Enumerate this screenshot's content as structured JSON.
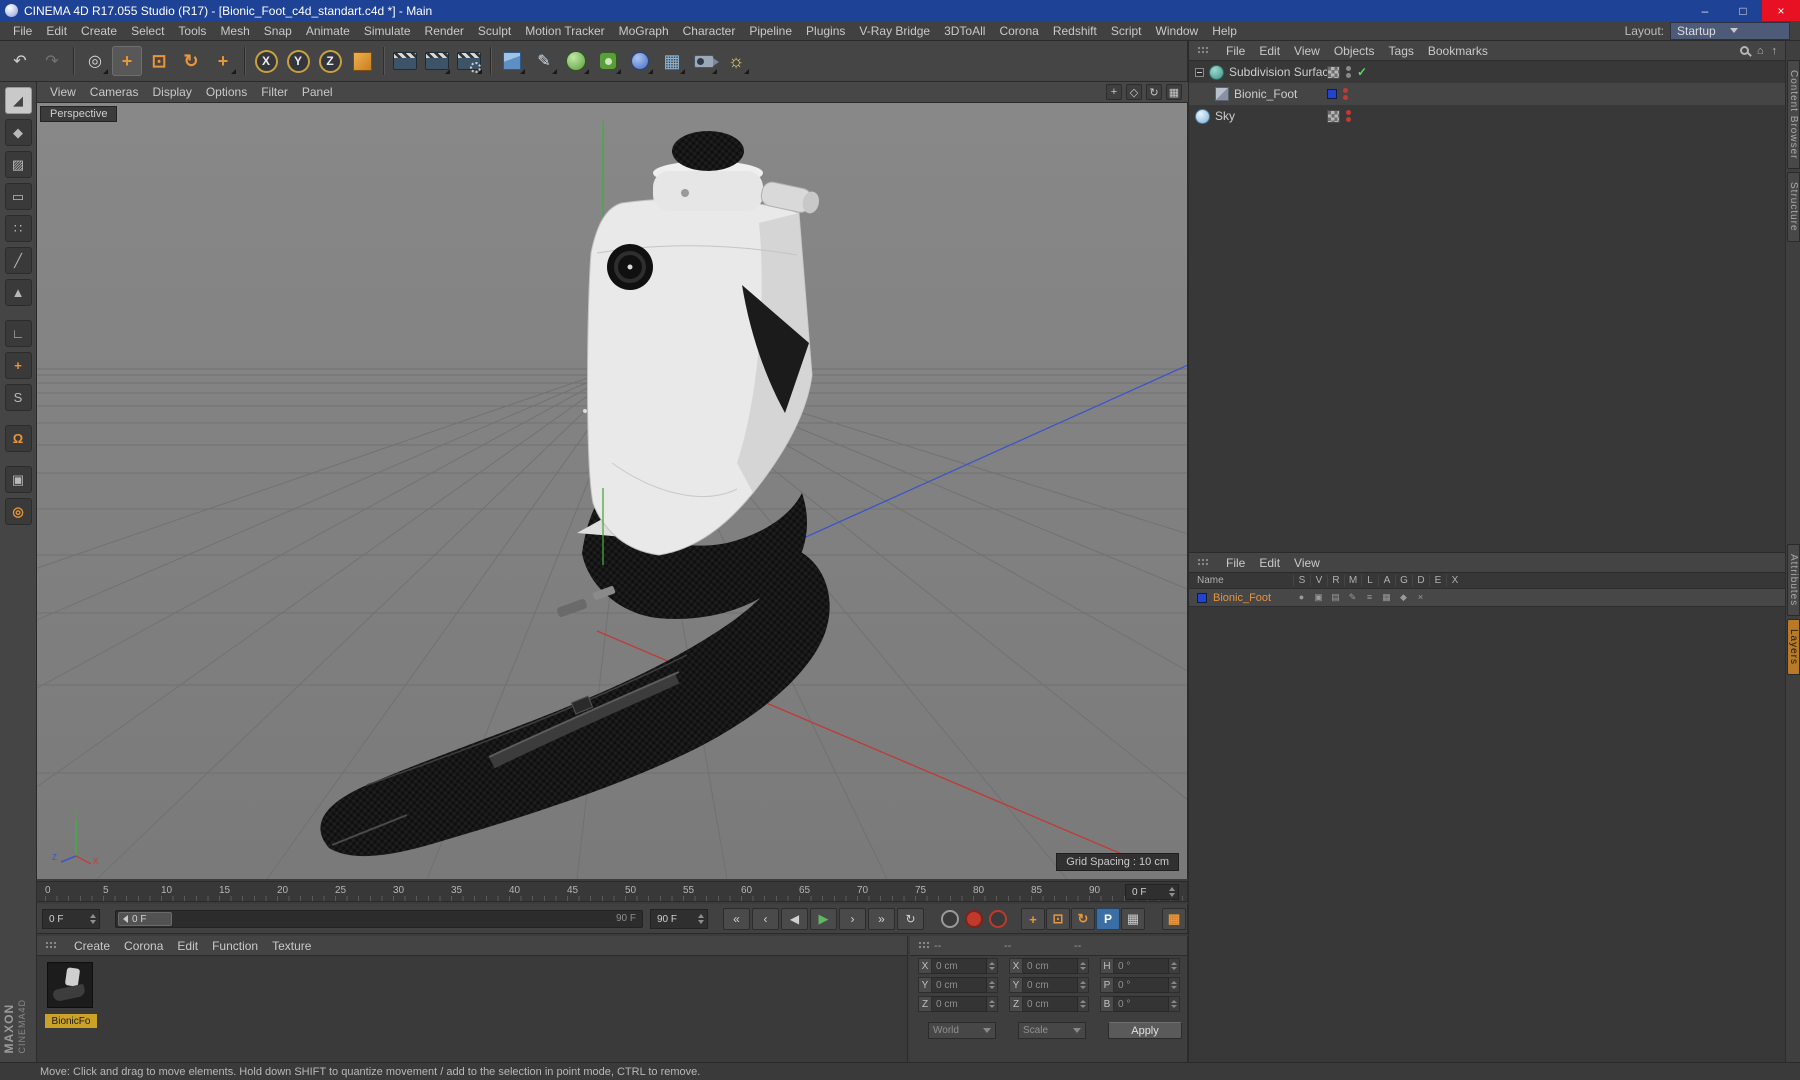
{
  "colors": {
    "title_blue": "#1e4296",
    "close_red": "#e81123",
    "accent_orange": "#e8953c",
    "play_green": "#5fb75f",
    "label_yellow": "#c9a227",
    "sel_orange": "#e39440"
  },
  "window": {
    "title": "CINEMA 4D R17.055 Studio (R17) - [Bionic_Foot_c4d_standart.c4d *] - Main",
    "minimize_glyph": "–",
    "maximize_glyph": "□",
    "close_glyph": "×"
  },
  "menubar": {
    "items": [
      "File",
      "Edit",
      "Create",
      "Select",
      "Tools",
      "Mesh",
      "Snap",
      "Animate",
      "Simulate",
      "Render",
      "Sculpt",
      "Motion Tracker",
      "MoGraph",
      "Character",
      "Pipeline",
      "Plugins",
      "V-Ray Bridge",
      "3DToAll",
      "Corona",
      "Redshift",
      "Script",
      "Window",
      "Help"
    ],
    "layout_label": "Layout:",
    "layout_value": "Startup"
  },
  "icons": {
    "undo": "↶",
    "redo": "↷",
    "selection": "◎",
    "move": "+",
    "scale": "⊡",
    "rotate": "↻",
    "last_tool": "+",
    "axis_x": "X",
    "axis_y": "Y",
    "axis_z": "Z",
    "pen": "✎",
    "floor": "▦",
    "light": "☼",
    "home": "⌂",
    "up_arrow": "↑",
    "p_key": "P",
    "grid": "▦",
    "transport": [
      "«",
      "‹",
      "◀",
      "▶",
      "›",
      "»",
      "↻"
    ],
    "record": [
      "●",
      "●",
      "◎"
    ],
    "viewport_nav": [
      "+",
      "◇",
      "↻",
      "▦"
    ]
  },
  "palette": [
    {
      "name": "make-editable",
      "glyph": "◢"
    },
    {
      "name": "model-mode",
      "glyph": "◆"
    },
    {
      "name": "texture-mode",
      "glyph": "▨"
    },
    {
      "name": "workplane-mode",
      "glyph": "▭"
    },
    {
      "name": "points-mode",
      "glyph": "∷"
    },
    {
      "name": "edges-mode",
      "glyph": "╱"
    },
    {
      "name": "polygons-mode",
      "glyph": "▲"
    },
    {
      "name": "axis-mode",
      "glyph": "∟"
    },
    {
      "name": "enable-axis",
      "glyph": "+"
    },
    {
      "name": "snap-settings",
      "glyph": "S"
    },
    {
      "name": "magnet-snap",
      "glyph": "Ω"
    },
    {
      "name": "lock-workplane",
      "glyph": "▣"
    },
    {
      "name": "quantize",
      "glyph": "◎"
    }
  ],
  "viewport": {
    "menus": [
      "View",
      "Cameras",
      "Display",
      "Options",
      "Filter",
      "Panel"
    ],
    "label": "Perspective",
    "grid_spacing": "Grid Spacing : 10 cm",
    "axis_x": "X",
    "axis_y": "Y",
    "axis_z": "Z"
  },
  "timeline": {
    "ticks": [
      "0",
      "5",
      "10",
      "15",
      "20",
      "25",
      "30",
      "35",
      "40",
      "45",
      "50",
      "55",
      "60",
      "65",
      "70",
      "75",
      "80",
      "85",
      "90"
    ],
    "current": "0 F",
    "range_start": "0 F",
    "range_end_label": "90 F",
    "range_end": "90 F"
  },
  "materials": {
    "menus": [
      "Create",
      "Corona",
      "Edit",
      "Function",
      "Texture"
    ],
    "material_name": "BionicFo"
  },
  "coordinates": {
    "dashes": [
      "--",
      "--",
      "--"
    ],
    "rows": [
      {
        "pos_label": "X",
        "pos": "0 cm",
        "size_label": "X",
        "size": "0 cm",
        "rot_label": "H",
        "rot": "0 °"
      },
      {
        "pos_label": "Y",
        "pos": "0 cm",
        "size_label": "Y",
        "size": "0 cm",
        "rot_label": "P",
        "rot": "0 °"
      },
      {
        "pos_label": "Z",
        "pos": "0 cm",
        "size_label": "Z",
        "size": "0 cm",
        "rot_label": "B",
        "rot": "0 °"
      }
    ],
    "world": "World",
    "scale": "Scale",
    "apply": "Apply"
  },
  "object_manager": {
    "menus": [
      "File",
      "Edit",
      "View",
      "Objects",
      "Tags",
      "Bookmarks"
    ],
    "items": [
      {
        "name": "Subdivision Surface"
      },
      {
        "name": "Bionic_Foot"
      },
      {
        "name": "Sky"
      }
    ]
  },
  "layer_manager": {
    "menus": [
      "File",
      "Edit",
      "View"
    ],
    "name_header": "Name",
    "columns": [
      "S",
      "V",
      "R",
      "M",
      "L",
      "A",
      "G",
      "D",
      "E",
      "X"
    ],
    "row_name": "Bionic_Foot",
    "row_icons": [
      "●",
      "▣",
      "▤",
      "✎",
      "≡",
      "▦",
      "◆",
      "×"
    ]
  },
  "side_tabs": {
    "tab1": "Content Browser",
    "tab2": "Structure",
    "tab3": "Attributes",
    "tab4": "Layers"
  },
  "branding": {
    "line1": "MAXON",
    "line2": "CINEMA4D"
  },
  "statusbar": {
    "text": "Move: Click and drag to move elements. Hold down SHIFT to quantize movement / add to the selection in point mode, CTRL to remove."
  }
}
